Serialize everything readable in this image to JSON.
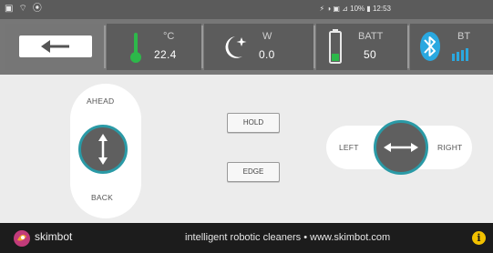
{
  "status_bar": {
    "left_icons": [
      "screenshot-icon",
      "cast-icon",
      "location-icon"
    ],
    "right_text": "⚡ ◑ ▣ ⊿ 10% ▮ 12:53"
  },
  "header": {
    "back_icon": "left-arrow-icon",
    "temperature": {
      "unit": "°C",
      "value": "22.4",
      "icon": "thermometer-icon",
      "color": "#2db84a"
    },
    "power": {
      "unit": "W",
      "value": "0.0",
      "icon": "moon-sparkle-icon"
    },
    "battery": {
      "unit": "BATT",
      "value": "50",
      "icon": "battery-icon",
      "color": "#2db84a"
    },
    "bluetooth": {
      "unit": "BT",
      "icon": "bluetooth-icon",
      "signal_bars": 4,
      "color": "#2aa8e0"
    }
  },
  "controls": {
    "ahead_label": "AHEAD",
    "back_label": "BACK",
    "hold_label": "HOLD",
    "edge_label": "EDGE",
    "left_label": "LEFT",
    "right_label": "RIGHT",
    "accent": "#2a9aa6"
  },
  "footer": {
    "brand": "skimbot",
    "tagline": "intelligent robotic cleaners • www.skimbot.com",
    "info_icon": "i"
  }
}
